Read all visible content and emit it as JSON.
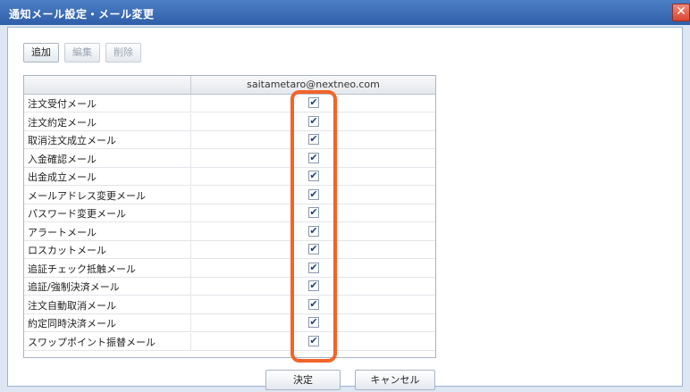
{
  "window": {
    "title": "通知メール設定・メール変更",
    "close_glyph": "✕"
  },
  "toolbar": {
    "add_label": "追加",
    "edit_label": "編集",
    "delete_label": "削除"
  },
  "grid": {
    "column_header": "saitametaro@nextneo.com",
    "rows": [
      {
        "label": "注文受付メール",
        "checked": true
      },
      {
        "label": "注文約定メール",
        "checked": true
      },
      {
        "label": "取消注文成立メール",
        "checked": true
      },
      {
        "label": "入金確認メール",
        "checked": true
      },
      {
        "label": "出金成立メール",
        "checked": true
      },
      {
        "label": "メールアドレス変更メール",
        "checked": true
      },
      {
        "label": "パスワード変更メール",
        "checked": true
      },
      {
        "label": "アラートメール",
        "checked": true
      },
      {
        "label": "ロスカットメール",
        "checked": true
      },
      {
        "label": "追証チェック抵触メール",
        "checked": true
      },
      {
        "label": "追証/強制決済メール",
        "checked": true
      },
      {
        "label": "注文自動取消メール",
        "checked": true
      },
      {
        "label": "約定同時決済メール",
        "checked": true
      },
      {
        "label": "スワップポイント振替メール",
        "checked": true
      }
    ],
    "check_glyph": "✔"
  },
  "footer": {
    "ok_label": "決定",
    "cancel_label": "キャンセル"
  },
  "colors": {
    "titlebar": "#2e5ea8",
    "highlight": "#f2642a",
    "close": "#d9462f"
  }
}
